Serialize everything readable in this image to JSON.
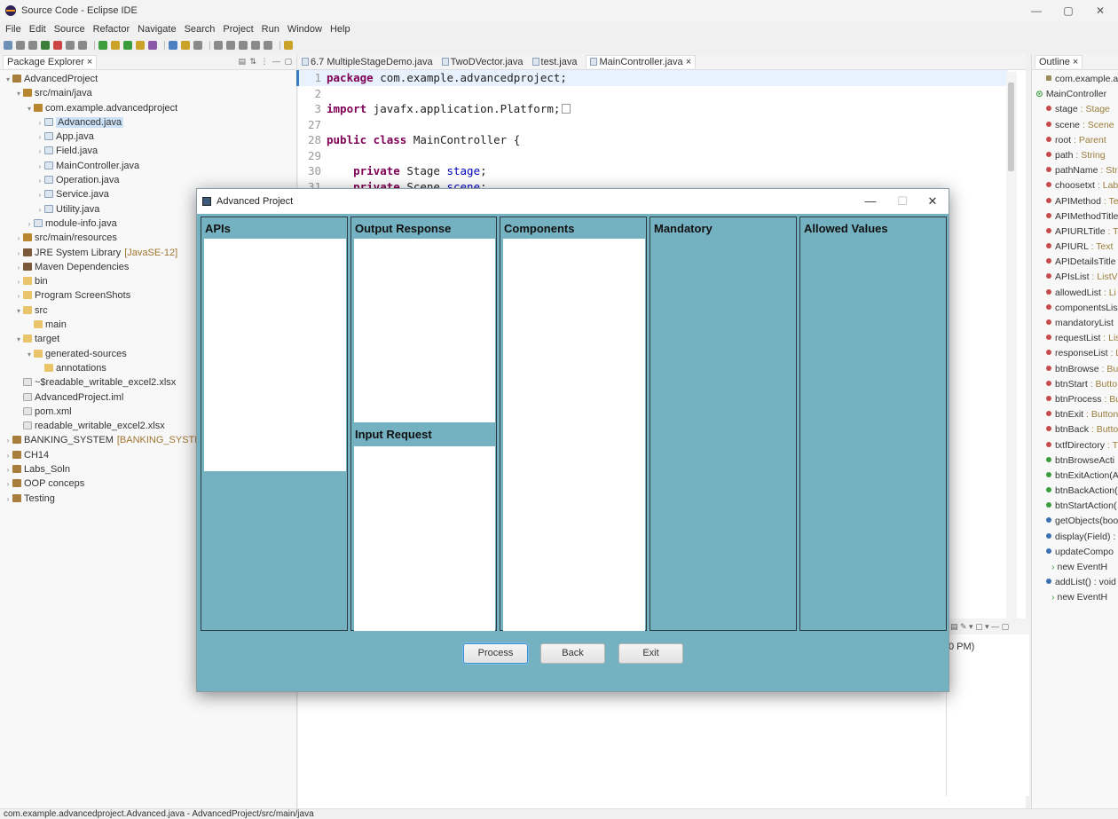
{
  "window": {
    "title": "Source Code - Eclipse IDE",
    "controls": {
      "minimize": "—",
      "maximize": "▢",
      "close": "✕"
    }
  },
  "menu": [
    "File",
    "Edit",
    "Source",
    "Refactor",
    "Navigate",
    "Search",
    "Project",
    "Run",
    "Window",
    "Help"
  ],
  "package_explorer": {
    "tab_label": "Package Explorer ×",
    "items": [
      {
        "label": "AdvancedProject",
        "depth": 0,
        "icon": "project-icon",
        "expanded": true
      },
      {
        "label": "src/main/java",
        "depth": 1,
        "icon": "source-folder-icon",
        "expanded": true
      },
      {
        "label": "com.example.advancedproject",
        "depth": 2,
        "icon": "package-icon",
        "expanded": true
      },
      {
        "label": "Advanced.java",
        "depth": 3,
        "icon": "java-file-icon",
        "expanded": false,
        "selected": true
      },
      {
        "label": "App.java",
        "depth": 3,
        "icon": "java-file-icon",
        "expanded": false
      },
      {
        "label": "Field.java",
        "depth": 3,
        "icon": "java-file-icon",
        "expanded": false
      },
      {
        "label": "MainController.java",
        "depth": 3,
        "icon": "java-file-icon",
        "expanded": false
      },
      {
        "label": "Operation.java",
        "depth": 3,
        "icon": "java-file-icon",
        "expanded": false
      },
      {
        "label": "Service.java",
        "depth": 3,
        "icon": "java-file-icon",
        "expanded": false
      },
      {
        "label": "Utility.java",
        "depth": 3,
        "icon": "java-file-icon",
        "expanded": false
      },
      {
        "label": "module-info.java",
        "depth": 2,
        "icon": "java-file-icon",
        "expanded": false
      },
      {
        "label": "src/main/resources",
        "depth": 1,
        "icon": "source-folder-icon",
        "expanded": false
      },
      {
        "label": "JRE System Library",
        "deco": "[JavaSE-12]",
        "depth": 1,
        "icon": "library-icon",
        "expanded": false
      },
      {
        "label": "Maven Dependencies",
        "depth": 1,
        "icon": "library-icon",
        "expanded": false
      },
      {
        "label": "bin",
        "depth": 1,
        "icon": "folder-icon",
        "expanded": false
      },
      {
        "label": "Program ScreenShots",
        "depth": 1,
        "icon": "folder-icon",
        "expanded": false
      },
      {
        "label": "src",
        "depth": 1,
        "icon": "folder-icon",
        "expanded": true
      },
      {
        "label": "main",
        "depth": 2,
        "icon": "folder-icon",
        "leaf": true
      },
      {
        "label": "target",
        "depth": 1,
        "icon": "folder-icon",
        "expanded": true
      },
      {
        "label": "generated-sources",
        "depth": 2,
        "icon": "folder-icon",
        "expanded": true
      },
      {
        "label": "annotations",
        "depth": 3,
        "icon": "folder-icon",
        "leaf": true
      },
      {
        "label": "~$readable_writable_excel2.xlsx",
        "depth": 1,
        "icon": "file-icon",
        "leaf": true
      },
      {
        "label": "AdvancedProject.iml",
        "depth": 1,
        "icon": "file-icon",
        "leaf": true
      },
      {
        "label": "pom.xml",
        "depth": 1,
        "icon": "file-icon",
        "leaf": true
      },
      {
        "label": "readable_writable_excel2.xlsx",
        "depth": 1,
        "icon": "file-icon",
        "leaf": true
      },
      {
        "label": "BANKING_SYSTEM",
        "deco": "[BANKING_SYSTEM main]",
        "depth": 0,
        "icon": "project-icon",
        "expanded": false
      },
      {
        "label": "CH14",
        "depth": 0,
        "icon": "project-icon",
        "expanded": false
      },
      {
        "label": "Labs_Soln",
        "depth": 0,
        "icon": "project-icon",
        "expanded": false
      },
      {
        "label": "OOP conceps",
        "depth": 0,
        "icon": "project-icon",
        "expanded": false
      },
      {
        "label": "Testing",
        "depth": 0,
        "icon": "project-icon",
        "expanded": false
      }
    ]
  },
  "editor": {
    "tabs": [
      {
        "label": "6.7 MultipleStageDemo.java",
        "active": false
      },
      {
        "label": "TwoDVector.java",
        "active": false
      },
      {
        "label": "test.java",
        "active": false
      },
      {
        "label": "MainController.java ×",
        "active": true
      }
    ],
    "lines": [
      {
        "num": "1",
        "parts": [
          {
            "kw": "package"
          },
          {
            "t": " com.example.advancedproject;"
          }
        ],
        "current": true
      },
      {
        "num": "2",
        "parts": []
      },
      {
        "num": "3",
        "parts": [
          {
            "kw": "import"
          },
          {
            "t": " javafx.application.Platform;"
          }
        ],
        "folded": true
      },
      {
        "num": "27",
        "parts": []
      },
      {
        "num": "28",
        "parts": [
          {
            "kw": "public class"
          },
          {
            "t": " MainController {"
          }
        ]
      },
      {
        "num": "29",
        "parts": []
      },
      {
        "num": "30",
        "parts": [
          {
            "t": "    "
          },
          {
            "kw": "private"
          },
          {
            "t": " Stage "
          },
          {
            "fld": "stage"
          },
          {
            "t": ";"
          }
        ]
      },
      {
        "num": "31",
        "parts": [
          {
            "t": "    "
          },
          {
            "kw": "private"
          },
          {
            "t": " Scene "
          },
          {
            "fld": "scene"
          },
          {
            "t": ";"
          }
        ]
      }
    ]
  },
  "outline": {
    "tab_label": "Outline ×",
    "package": "com.example.adva",
    "class_name": "MainController",
    "items": [
      {
        "name": "stage",
        "type": " : Stage",
        "kind": "field"
      },
      {
        "name": "scene",
        "type": " : Scene",
        "kind": "field"
      },
      {
        "name": "root",
        "type": " : Parent",
        "kind": "field"
      },
      {
        "name": "path",
        "type": " : String",
        "kind": "field"
      },
      {
        "name": "pathName",
        "type": " : Str",
        "kind": "field"
      },
      {
        "name": "choosetxt",
        "type": " : Lab",
        "kind": "field"
      },
      {
        "name": "APIMethod",
        "type": " : Te",
        "kind": "field"
      },
      {
        "name": "APIMethodTitle",
        "type": "",
        "kind": "field"
      },
      {
        "name": "APIURLTitle",
        "type": " : Te",
        "kind": "field"
      },
      {
        "name": "APIURL",
        "type": " : Text",
        "kind": "field"
      },
      {
        "name": "APIDetailsTitle",
        "type": "",
        "kind": "field"
      },
      {
        "name": "APIsList",
        "type": " : ListVi",
        "kind": "field"
      },
      {
        "name": "allowedList",
        "type": " : Li",
        "kind": "field"
      },
      {
        "name": "componentsLis",
        "type": "",
        "kind": "field"
      },
      {
        "name": "mandatoryList",
        "type": "",
        "kind": "field"
      },
      {
        "name": "requestList",
        "type": " : Lis",
        "kind": "field"
      },
      {
        "name": "responseList",
        "type": " : L",
        "kind": "field"
      },
      {
        "name": "btnBrowse",
        "type": " : Bu",
        "kind": "field"
      },
      {
        "name": "btnStart",
        "type": " : Butto",
        "kind": "field"
      },
      {
        "name": "btnProcess",
        "type": " : Bu",
        "kind": "field"
      },
      {
        "name": "btnExit",
        "type": " : Button",
        "kind": "field"
      },
      {
        "name": "btnBack",
        "type": " : Butto",
        "kind": "field"
      },
      {
        "name": "txtfDirectory",
        "type": " : T",
        "kind": "field"
      },
      {
        "name": "btnBrowseActi",
        "type": "",
        "kind": "method"
      },
      {
        "name": "btnExitAction(A",
        "type": "",
        "kind": "method"
      },
      {
        "name": "btnBackAction(",
        "type": "",
        "kind": "method"
      },
      {
        "name": "btnStartAction(",
        "type": "",
        "kind": "method"
      },
      {
        "name": "getObjects(boo",
        "type": "",
        "kind": "pkg-method"
      },
      {
        "name": "display(Field) :",
        "type": "",
        "kind": "pkg-method"
      },
      {
        "name": "updateCompo",
        "type": "",
        "kind": "pkg-method"
      },
      {
        "name": "new EventH",
        "type": "",
        "kind": "anon"
      },
      {
        "name": "addList() : void",
        "type": "",
        "kind": "pkg-method"
      },
      {
        "name": "new EventH",
        "type": "",
        "kind": "anon"
      }
    ]
  },
  "console": {
    "text": "0 PM)"
  },
  "status_bar": {
    "text": "com.example.advancedproject.Advanced.java - AdvancedProject/src/main/java"
  },
  "dialog": {
    "title": "Advanced Project",
    "controls": {
      "minimize": "—",
      "maximize": "☐",
      "close": "✕"
    },
    "panels": {
      "apis": "APIs",
      "output_response": "Output Response",
      "input_request": "Input Request",
      "components": "Components",
      "mandatory": "Mandatory",
      "allowed_values": "Allowed Values"
    },
    "buttons": {
      "process": "Process",
      "back": "Back",
      "exit": "Exit"
    },
    "colors": {
      "background": "#74b1c1",
      "list": "#ffffff"
    }
  }
}
